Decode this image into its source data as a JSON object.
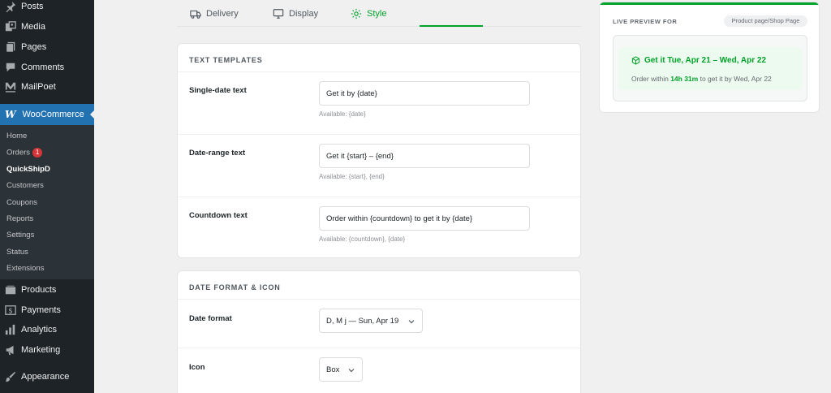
{
  "sidebar": {
    "top_items": [
      {
        "label": "Posts",
        "icon": "pin-icon"
      },
      {
        "label": "Media",
        "icon": "media-icon"
      },
      {
        "label": "Pages",
        "icon": "pages-icon"
      },
      {
        "label": "Comments",
        "icon": "comments-icon"
      },
      {
        "label": "MailPoet",
        "icon": "mailpoet-icon"
      }
    ],
    "woocommerce": {
      "logo": "W",
      "label": "WooCommerce"
    },
    "submenu": [
      {
        "label": "Home"
      },
      {
        "label": "Orders",
        "badge": "1"
      },
      {
        "label": "QuickShipD"
      },
      {
        "label": "Customers"
      },
      {
        "label": "Coupons"
      },
      {
        "label": "Reports"
      },
      {
        "label": "Settings"
      },
      {
        "label": "Status"
      },
      {
        "label": "Extensions"
      }
    ],
    "bottom_items": [
      {
        "label": "Products",
        "icon": "products-icon"
      },
      {
        "label": "Payments",
        "icon": "payments-icon"
      },
      {
        "label": "Analytics",
        "icon": "analytics-icon"
      },
      {
        "label": "Marketing",
        "icon": "megaphone-icon"
      },
      {
        "label": "Appearance",
        "icon": "brush-icon"
      }
    ]
  },
  "tabs": [
    {
      "label": "Delivery",
      "icon": "truck-icon"
    },
    {
      "label": "Display",
      "icon": "monitor-icon"
    },
    {
      "label": "Style",
      "icon": "sparkle-icon",
      "active": true
    }
  ],
  "text_templates": {
    "title": "TEXT TEMPLATES",
    "rows": [
      {
        "label": "Single-date text",
        "value": "Get it by {date}",
        "hint": "Available: {date}"
      },
      {
        "label": "Date-range text",
        "value": "Get it {start} – {end}",
        "hint": "Available: {start}, {end}"
      },
      {
        "label": "Countdown text",
        "value": "Order within {countdown} to get it by {date}",
        "hint": "Available: {countdown}, {date}"
      }
    ]
  },
  "date_format": {
    "title": "DATE FORMAT & ICON",
    "format_label": "Date format",
    "format_value": "D, M j — Sun, Apr 19",
    "icon_label": "Icon",
    "icon_value": "Box"
  },
  "preview": {
    "title": "LIVE PREVIEW FOR",
    "context": "Product page/Shop Page",
    "headline": "Get it Tue, Apr 21 – Wed, Apr 22",
    "sub_prefix": "Order within ",
    "sub_countdown": "14h 31m",
    "sub_suffix": " to get it by Wed, Apr 22"
  },
  "colors": {
    "accent": "#00a32a",
    "sidebar_bg": "#1d2327",
    "active_menu": "#2271b1"
  }
}
